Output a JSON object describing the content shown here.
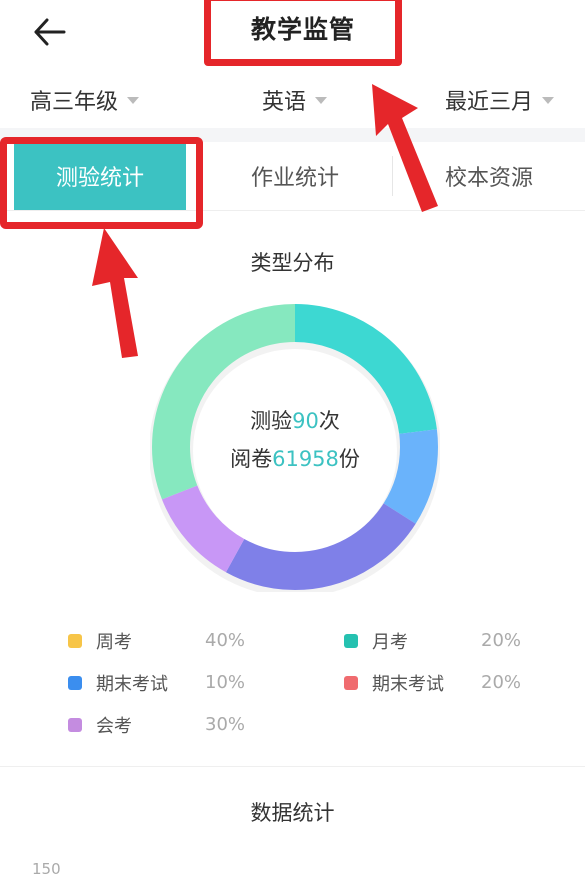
{
  "header": {
    "title": "教学监管"
  },
  "filters": [
    {
      "label": "高三年级"
    },
    {
      "label": "英语"
    },
    {
      "label": "最近三月"
    }
  ],
  "tabs": [
    {
      "label": "测验统计",
      "active": true
    },
    {
      "label": "作业统计",
      "active": false
    },
    {
      "label": "校本资源",
      "active": false
    }
  ],
  "type_distribution": {
    "title": "类型分布",
    "center": {
      "quiz_prefix": "测验",
      "quiz_count": "90",
      "quiz_suffix": "次",
      "paper_prefix": "阅卷",
      "paper_count": "61958",
      "paper_suffix": "份"
    },
    "segments": [
      {
        "color": "#3dd8d2",
        "value": 23
      },
      {
        "color": "#6ab3fb",
        "value": 11
      },
      {
        "color": "#7f80e8",
        "value": 24
      },
      {
        "color": "#c897f6",
        "value": 11
      },
      {
        "color": "#86e8bf",
        "value": 31
      }
    ],
    "legend": [
      {
        "name": "周考",
        "percent": "40%",
        "color": "#f7c548"
      },
      {
        "name": "月考",
        "percent": "20%",
        "color": "#25c1b0"
      },
      {
        "name": "期末考试",
        "percent": "10%",
        "color": "#3b8eef"
      },
      {
        "name": "期末考试",
        "percent": "20%",
        "color": "#f06b6f"
      },
      {
        "name": "会考",
        "percent": "30%",
        "color": "#c48ce0"
      }
    ]
  },
  "data_stats": {
    "title": "数据统计",
    "y_axis_top": "150"
  },
  "colors": {
    "accent": "#3cc2c2",
    "annotation_red": "#e5262a"
  }
}
